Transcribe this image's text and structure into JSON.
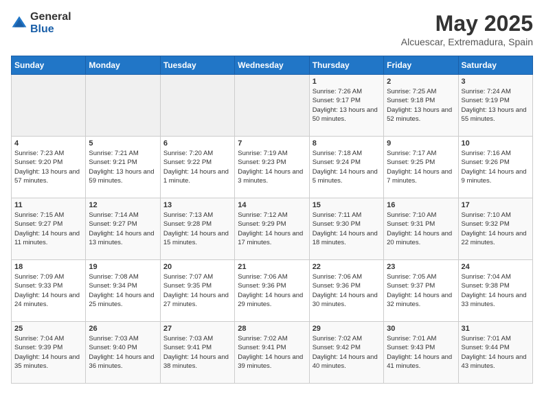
{
  "header": {
    "logo_general": "General",
    "logo_blue": "Blue",
    "title": "May 2025",
    "subtitle": "Alcuescar, Extremadura, Spain"
  },
  "calendar": {
    "days_of_week": [
      "Sunday",
      "Monday",
      "Tuesday",
      "Wednesday",
      "Thursday",
      "Friday",
      "Saturday"
    ],
    "weeks": [
      [
        {
          "day": "",
          "sunrise": "",
          "sunset": "",
          "daylight": "",
          "empty": true
        },
        {
          "day": "",
          "sunrise": "",
          "sunset": "",
          "daylight": "",
          "empty": true
        },
        {
          "day": "",
          "sunrise": "",
          "sunset": "",
          "daylight": "",
          "empty": true
        },
        {
          "day": "",
          "sunrise": "",
          "sunset": "",
          "daylight": "",
          "empty": true
        },
        {
          "day": "1",
          "sunrise": "Sunrise: 7:26 AM",
          "sunset": "Sunset: 9:17 PM",
          "daylight": "Daylight: 13 hours and 50 minutes."
        },
        {
          "day": "2",
          "sunrise": "Sunrise: 7:25 AM",
          "sunset": "Sunset: 9:18 PM",
          "daylight": "Daylight: 13 hours and 52 minutes."
        },
        {
          "day": "3",
          "sunrise": "Sunrise: 7:24 AM",
          "sunset": "Sunset: 9:19 PM",
          "daylight": "Daylight: 13 hours and 55 minutes."
        }
      ],
      [
        {
          "day": "4",
          "sunrise": "Sunrise: 7:23 AM",
          "sunset": "Sunset: 9:20 PM",
          "daylight": "Daylight: 13 hours and 57 minutes."
        },
        {
          "day": "5",
          "sunrise": "Sunrise: 7:21 AM",
          "sunset": "Sunset: 9:21 PM",
          "daylight": "Daylight: 13 hours and 59 minutes."
        },
        {
          "day": "6",
          "sunrise": "Sunrise: 7:20 AM",
          "sunset": "Sunset: 9:22 PM",
          "daylight": "Daylight: 14 hours and 1 minute."
        },
        {
          "day": "7",
          "sunrise": "Sunrise: 7:19 AM",
          "sunset": "Sunset: 9:23 PM",
          "daylight": "Daylight: 14 hours and 3 minutes."
        },
        {
          "day": "8",
          "sunrise": "Sunrise: 7:18 AM",
          "sunset": "Sunset: 9:24 PM",
          "daylight": "Daylight: 14 hours and 5 minutes."
        },
        {
          "day": "9",
          "sunrise": "Sunrise: 7:17 AM",
          "sunset": "Sunset: 9:25 PM",
          "daylight": "Daylight: 14 hours and 7 minutes."
        },
        {
          "day": "10",
          "sunrise": "Sunrise: 7:16 AM",
          "sunset": "Sunset: 9:26 PM",
          "daylight": "Daylight: 14 hours and 9 minutes."
        }
      ],
      [
        {
          "day": "11",
          "sunrise": "Sunrise: 7:15 AM",
          "sunset": "Sunset: 9:27 PM",
          "daylight": "Daylight: 14 hours and 11 minutes."
        },
        {
          "day": "12",
          "sunrise": "Sunrise: 7:14 AM",
          "sunset": "Sunset: 9:27 PM",
          "daylight": "Daylight: 14 hours and 13 minutes."
        },
        {
          "day": "13",
          "sunrise": "Sunrise: 7:13 AM",
          "sunset": "Sunset: 9:28 PM",
          "daylight": "Daylight: 14 hours and 15 minutes."
        },
        {
          "day": "14",
          "sunrise": "Sunrise: 7:12 AM",
          "sunset": "Sunset: 9:29 PM",
          "daylight": "Daylight: 14 hours and 17 minutes."
        },
        {
          "day": "15",
          "sunrise": "Sunrise: 7:11 AM",
          "sunset": "Sunset: 9:30 PM",
          "daylight": "Daylight: 14 hours and 18 minutes."
        },
        {
          "day": "16",
          "sunrise": "Sunrise: 7:10 AM",
          "sunset": "Sunset: 9:31 PM",
          "daylight": "Daylight: 14 hours and 20 minutes."
        },
        {
          "day": "17",
          "sunrise": "Sunrise: 7:10 AM",
          "sunset": "Sunset: 9:32 PM",
          "daylight": "Daylight: 14 hours and 22 minutes."
        }
      ],
      [
        {
          "day": "18",
          "sunrise": "Sunrise: 7:09 AM",
          "sunset": "Sunset: 9:33 PM",
          "daylight": "Daylight: 14 hours and 24 minutes."
        },
        {
          "day": "19",
          "sunrise": "Sunrise: 7:08 AM",
          "sunset": "Sunset: 9:34 PM",
          "daylight": "Daylight: 14 hours and 25 minutes."
        },
        {
          "day": "20",
          "sunrise": "Sunrise: 7:07 AM",
          "sunset": "Sunset: 9:35 PM",
          "daylight": "Daylight: 14 hours and 27 minutes."
        },
        {
          "day": "21",
          "sunrise": "Sunrise: 7:06 AM",
          "sunset": "Sunset: 9:36 PM",
          "daylight": "Daylight: 14 hours and 29 minutes."
        },
        {
          "day": "22",
          "sunrise": "Sunrise: 7:06 AM",
          "sunset": "Sunset: 9:36 PM",
          "daylight": "Daylight: 14 hours and 30 minutes."
        },
        {
          "day": "23",
          "sunrise": "Sunrise: 7:05 AM",
          "sunset": "Sunset: 9:37 PM",
          "daylight": "Daylight: 14 hours and 32 minutes."
        },
        {
          "day": "24",
          "sunrise": "Sunrise: 7:04 AM",
          "sunset": "Sunset: 9:38 PM",
          "daylight": "Daylight: 14 hours and 33 minutes."
        }
      ],
      [
        {
          "day": "25",
          "sunrise": "Sunrise: 7:04 AM",
          "sunset": "Sunset: 9:39 PM",
          "daylight": "Daylight: 14 hours and 35 minutes."
        },
        {
          "day": "26",
          "sunrise": "Sunrise: 7:03 AM",
          "sunset": "Sunset: 9:40 PM",
          "daylight": "Daylight: 14 hours and 36 minutes."
        },
        {
          "day": "27",
          "sunrise": "Sunrise: 7:03 AM",
          "sunset": "Sunset: 9:41 PM",
          "daylight": "Daylight: 14 hours and 38 minutes."
        },
        {
          "day": "28",
          "sunrise": "Sunrise: 7:02 AM",
          "sunset": "Sunset: 9:41 PM",
          "daylight": "Daylight: 14 hours and 39 minutes."
        },
        {
          "day": "29",
          "sunrise": "Sunrise: 7:02 AM",
          "sunset": "Sunset: 9:42 PM",
          "daylight": "Daylight: 14 hours and 40 minutes."
        },
        {
          "day": "30",
          "sunrise": "Sunrise: 7:01 AM",
          "sunset": "Sunset: 9:43 PM",
          "daylight": "Daylight: 14 hours and 41 minutes."
        },
        {
          "day": "31",
          "sunrise": "Sunrise: 7:01 AM",
          "sunset": "Sunset: 9:44 PM",
          "daylight": "Daylight: 14 hours and 43 minutes."
        }
      ]
    ]
  }
}
